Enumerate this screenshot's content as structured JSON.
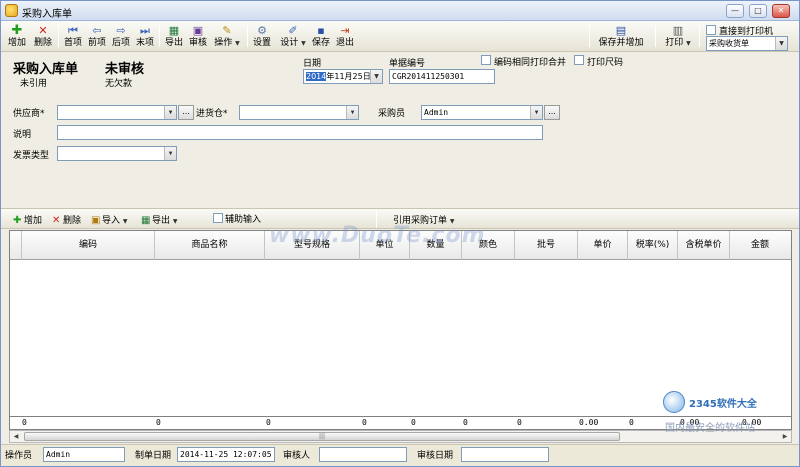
{
  "window": {
    "title": "采购入库单",
    "min_icon": "minimize-icon",
    "max_icon": "maximize-icon",
    "close_icon": "close-icon"
  },
  "toolbar": {
    "add": "增加",
    "delete": "删除",
    "first": "首项",
    "prev": "前项",
    "next": "后项",
    "last": "末项",
    "export": "导出",
    "audit": "审核",
    "operate": "操作",
    "settings": "设置",
    "design": "设计",
    "save": "保存",
    "exit": "退出",
    "save_and_add": "保存并增加",
    "print": "打印",
    "direct_print_label": "直接到打印机",
    "print_template": "采购收货单"
  },
  "header": {
    "doc_title": "采购入库单",
    "quote_status": "未引用",
    "audit_status": "未审核",
    "payment_status": "无欠款",
    "date_label": "日期",
    "date_value": "2014年11月25日",
    "docno_label": "单据编号",
    "docno_value": "CGR201411250301",
    "merge_label": "编码相同打印合并",
    "print_size_label": "打印尺码"
  },
  "form": {
    "supplier_label": "供应商*",
    "supplier_value": "",
    "warehouse_label": "进货仓*",
    "warehouse_value": "",
    "buyer_label": "采购员",
    "buyer_value": "Admin",
    "note_label": "说明",
    "note_value": "",
    "invoice_label": "发票类型",
    "invoice_value": ""
  },
  "gridbar": {
    "add": "增加",
    "delete": "删除",
    "import": "导入",
    "export": "导出",
    "assist_input": "辅助输入",
    "ref_order": "引用采购订单"
  },
  "grid": {
    "columns": [
      "编码",
      "商品名称",
      "型号规格",
      "单位",
      "数量",
      "颜色",
      "批号",
      "单价",
      "税率(%)",
      "含税单价",
      "金额"
    ],
    "footer": [
      "0",
      "0",
      "0",
      "0",
      "0",
      "0",
      "0",
      "0.00",
      "0",
      "0.00",
      "0.00"
    ]
  },
  "status": {
    "operator_label": "操作员",
    "operator_value": "Admin",
    "made_date_label": "制单日期",
    "made_date_value": "2014-11-25 12:07:05",
    "auditor_label": "审核人",
    "auditor_value": "",
    "audit_date_label": "审核日期",
    "audit_date_value": ""
  },
  "watermarks": {
    "duote": "www.DuoTe.com",
    "site_name": "2345软件大全",
    "site_slogan": "国内最安全的软件站"
  },
  "colors": {
    "accent": "#316ac5",
    "add_icon": "#1e9e1e",
    "delete_icon": "#cc2222",
    "nav_icon": "#3a62b8"
  }
}
